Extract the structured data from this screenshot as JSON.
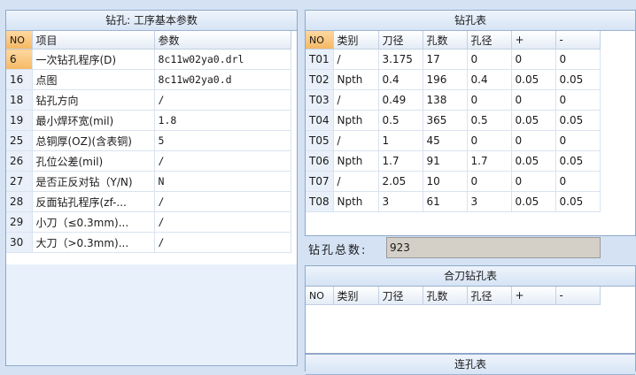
{
  "left_panel": {
    "title": "钻孔: 工序基本参数",
    "columns": [
      "NO",
      "项目",
      "参数"
    ],
    "rows": [
      {
        "no": "6",
        "item": "一次钻孔程序(D)",
        "value": "8c11w02ya0.drl"
      },
      {
        "no": "16",
        "item": "点图",
        "value": "8c11w02ya0.d"
      },
      {
        "no": "18",
        "item": "钻孔方向",
        "value": "/"
      },
      {
        "no": "19",
        "item": "最小焊环宽(mil)",
        "value": "1.8"
      },
      {
        "no": "25",
        "item": "总铜厚(OZ)(含表铜)",
        "value": "5"
      },
      {
        "no": "26",
        "item": "孔位公差(mil)",
        "value": "/"
      },
      {
        "no": "27",
        "item": "是否正反对钻（Y/N)",
        "value": "N"
      },
      {
        "no": "28",
        "item": "反面钻孔程序(zf-...",
        "value": "/"
      },
      {
        "no": "29",
        "item": "小刀（≤0.3mm)...",
        "value": "/"
      },
      {
        "no": "30",
        "item": "大刀（>0.3mm)...",
        "value": "/"
      }
    ]
  },
  "drill_table": {
    "title": "钻孔表",
    "columns": [
      "NO",
      "类别",
      "刀径",
      "孔数",
      "孔径",
      "+",
      "-"
    ],
    "rows": [
      [
        "T01",
        "/",
        "3.175",
        "17",
        "0",
        "0",
        "0"
      ],
      [
        "T02",
        "Npth",
        "0.4",
        "196",
        "0.4",
        "0.05",
        "0.05"
      ],
      [
        "T03",
        "/",
        "0.49",
        "138",
        "0",
        "0",
        "0"
      ],
      [
        "T04",
        "Npth",
        "0.5",
        "365",
        "0.5",
        "0.05",
        "0.05"
      ],
      [
        "T05",
        "/",
        "1",
        "45",
        "0",
        "0",
        "0"
      ],
      [
        "T06",
        "Npth",
        "1.7",
        "91",
        "1.7",
        "0.05",
        "0.05"
      ],
      [
        "T07",
        "/",
        "2.05",
        "10",
        "0",
        "0",
        "0"
      ],
      [
        "T08",
        "Npth",
        "3",
        "61",
        "3",
        "0.05",
        "0.05"
      ]
    ]
  },
  "total": {
    "label": "钻孔总数:",
    "value": "923"
  },
  "combined_table": {
    "title": "合刀钻孔表",
    "columns": [
      "NO",
      "类别",
      "刀径",
      "孔数",
      "孔径",
      "+",
      "-"
    ]
  },
  "slot_table": {
    "title": "连孔表"
  }
}
